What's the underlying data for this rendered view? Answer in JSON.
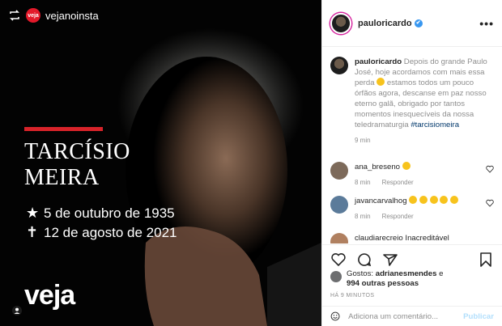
{
  "image": {
    "repost_handle": "vejanoinsta",
    "veja_badge": "veja",
    "name_lines": [
      "TARCÍSIO",
      "MEIRA"
    ],
    "birth": {
      "glyph": "★",
      "date": "5 de outubro de 1935"
    },
    "death": {
      "glyph": "✝",
      "date": "12 de agosto de 2021"
    },
    "logo": "veja",
    "colors": {
      "accent": "#d8232a",
      "background": "#000000"
    }
  },
  "header": {
    "username": "pauloricardo",
    "verified": "✔",
    "more": "•••"
  },
  "caption": {
    "username": "pauloricardo",
    "text_a": "Depois do grande Paulo José, hoje acordamos com mais essa perda",
    "text_b": "estamos todos um pouco órfãos agora, descanse em paz nosso eterno galã, obrigado por tantos momentos inesquecíveis da nossa teledramaturgia",
    "hashtag": "#tarcisiomeira",
    "time": "9 min"
  },
  "comments": [
    {
      "user": "ana_breseno",
      "time": "8 min",
      "reply": "Responder"
    },
    {
      "user": "javancarvalhog",
      "time": "8 min",
      "reply": "Responder"
    },
    {
      "user": "claudiarecreio",
      "text": "Inacreditável"
    }
  ],
  "likes": {
    "prefix": "Gostos:",
    "user": "adrianesmendes",
    "connector": "e",
    "others": "994 outras pessoas"
  },
  "post_time": "HÁ 9 MINUTOS",
  "comment_box": {
    "placeholder": "Adiciona um comentário...",
    "post_label": "Publicar"
  }
}
